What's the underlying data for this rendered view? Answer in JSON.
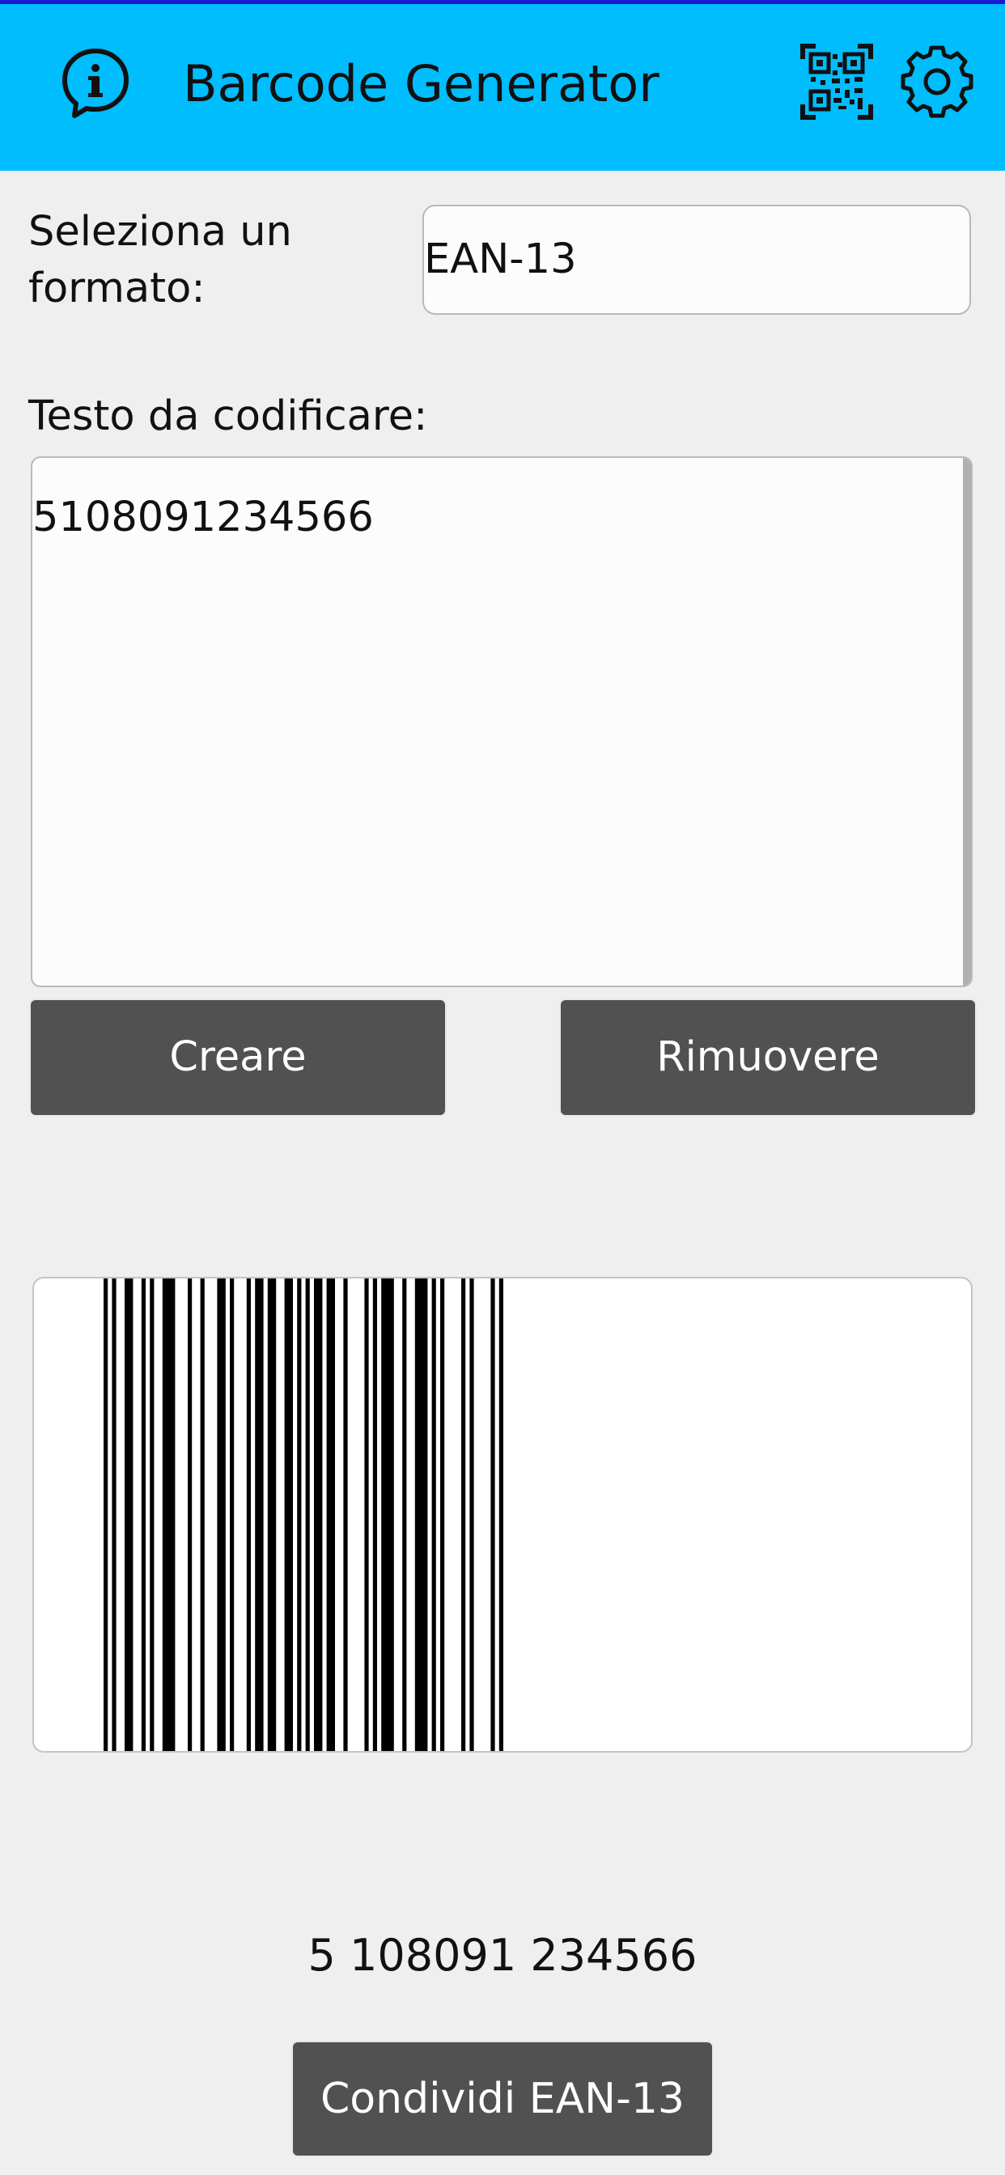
{
  "app": {
    "title": "Barcode Generator",
    "colors": {
      "appbar": "#00bdfd",
      "button": "#515151",
      "background": "#efefef"
    }
  },
  "header": {
    "info_icon": "info-icon",
    "qr_icon": "qr-code-icon",
    "settings_icon": "gear-icon"
  },
  "form": {
    "format_label": "Seleziona un formato:",
    "format_value": "EAN-13",
    "text_label": "Testo da codificare:",
    "text_value": "5108091234566"
  },
  "buttons": {
    "create": "Creare",
    "remove": "Rimuovere",
    "share": "Condividi EAN-13"
  },
  "barcode": {
    "format": "EAN-13",
    "human_readable": "5 108091 234566"
  }
}
